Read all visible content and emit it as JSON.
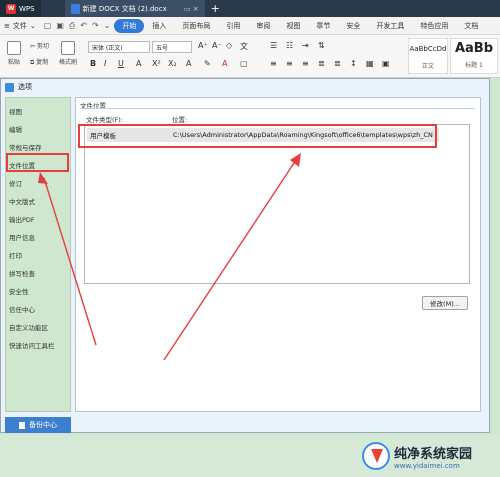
{
  "tabbar": {
    "app": "WPS",
    "doc_tab": "新建 DOCX 文档 (2).docx",
    "new_tab": "+"
  },
  "menubar": {
    "file": "文件",
    "tabs": [
      "开始",
      "插入",
      "页面布局",
      "引用",
      "审阅",
      "视图",
      "章节",
      "安全",
      "开发工具",
      "特色应用",
      "文档"
    ]
  },
  "ribbon": {
    "paste": "粘贴",
    "cut": "剪切",
    "copy": "复制",
    "format_painter": "格式刷",
    "font_name": "宋体 (正文)",
    "font_size": "五号",
    "styles": [
      {
        "sample": "AaBbCcDd",
        "name": "正文"
      },
      {
        "sample": "AaBb",
        "name": "标题 1"
      }
    ]
  },
  "dialog": {
    "title": "选项",
    "nav_items": [
      "视图",
      "编辑",
      "常规与保存",
      "文件位置",
      "修订",
      "中文版式",
      "输出PDF",
      "用户信息",
      "打印",
      "拼写检查",
      "安全性",
      "信任中心",
      "自定义功能区",
      "快速访问工具栏"
    ],
    "selected_nav": "文件位置",
    "backup_button": "备份中心",
    "group_label": "文件位置",
    "col_type": "文件类型(F):",
    "col_location": "位置:",
    "rows": [
      {
        "type": "用户模板",
        "path": "C:\\Users\\Administrator\\AppData\\Roaming\\Kingsoft\\office6\\templates\\wps\\zh_CN"
      }
    ],
    "modify_button": "修改(M)..."
  },
  "watermark": {
    "title": "纯净系统家园",
    "url": "www.yidaimei.com"
  },
  "colors": {
    "accent": "#3478d8",
    "highlight": "#e53e3e",
    "nav_bg": "#cfe7cf"
  }
}
